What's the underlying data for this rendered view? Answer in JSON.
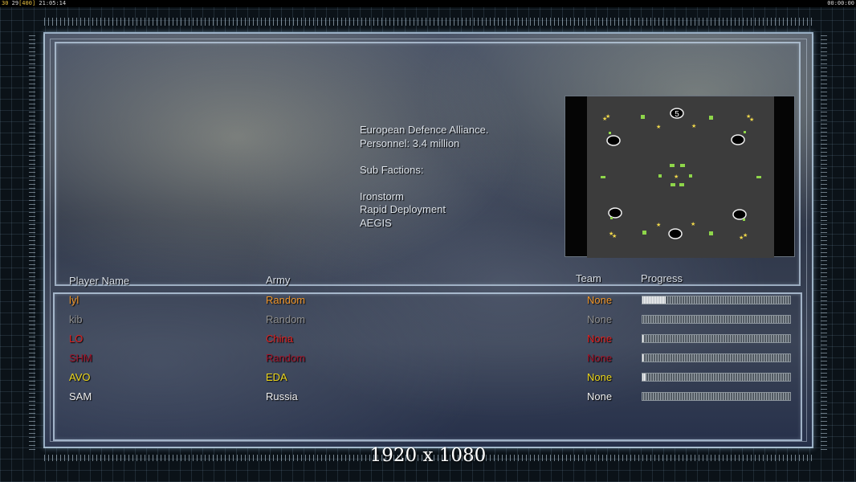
{
  "overlay": {
    "frame_left": "30",
    "fps": "29",
    "fps_cap": "[400]",
    "clock": "21:05:14",
    "elapsed": "00:00:00"
  },
  "faction": {
    "description": [
      "European Defence Alliance.",
      "Personnel: 3.4 million",
      "",
      "Sub Factions:",
      "",
      "Ironstorm",
      "Rapid Deployment",
      "AEGIS"
    ]
  },
  "minimap": {
    "player_marker_label": "5"
  },
  "lobby": {
    "headers": {
      "player_name": "Player Name",
      "army": "Army",
      "team": "Team",
      "progress": "Progress"
    },
    "players": [
      {
        "name": "lyl",
        "army": "Random",
        "team": "None",
        "color": "#f0962a",
        "progress": 0.16
      },
      {
        "name": "kib",
        "army": "Random",
        "team": "None",
        "color": "#909090",
        "progress": 0.0
      },
      {
        "name": "LO",
        "army": "China",
        "team": "None",
        "color": "#e02020",
        "progress": 0.01
      },
      {
        "name": "SHM",
        "army": "Random",
        "team": "None",
        "color": "#a0142a",
        "progress": 0.01
      },
      {
        "name": "AVO",
        "army": "EDA",
        "team": "None",
        "color": "#eed81c",
        "progress": 0.02
      },
      {
        "name": "SAM",
        "army": "Russia",
        "team": "None",
        "color": "#f0f0f0",
        "progress": 0.0
      }
    ]
  },
  "resolution_label": "1920 x 1080"
}
